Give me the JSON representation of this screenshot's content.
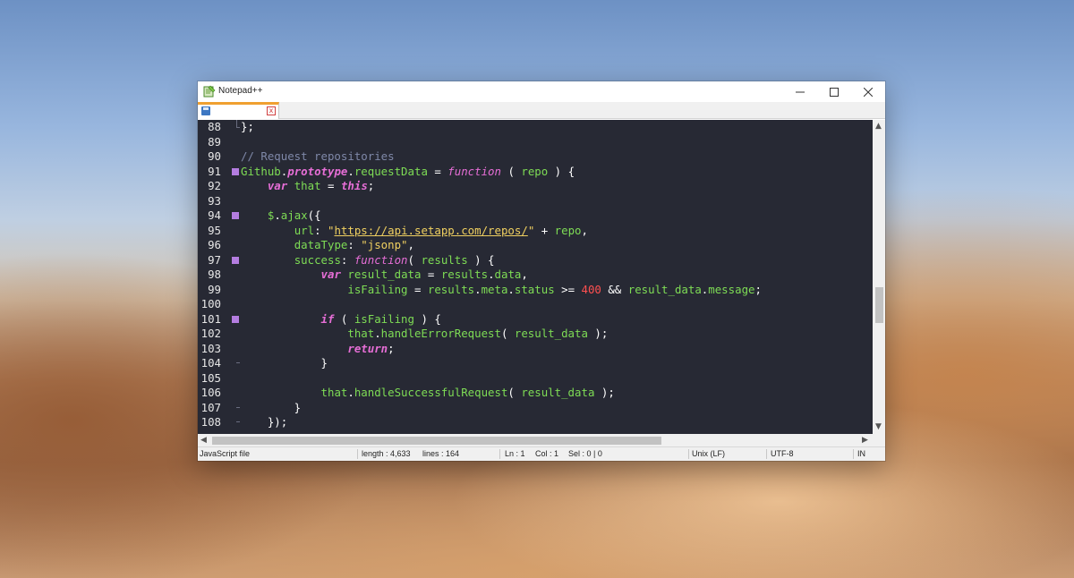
{
  "window": {
    "title": "Notepad++",
    "controls": {
      "minimize": "—",
      "maximize": "☐",
      "close": "✕"
    }
  },
  "tabs": [
    {
      "label": "",
      "close": "x"
    }
  ],
  "editor": {
    "lines": [
      {
        "n": "88",
        "fold": "tick",
        "tokens": [
          [
            "op",
            "};"
          ]
        ]
      },
      {
        "n": "89",
        "fold": "",
        "tokens": []
      },
      {
        "n": "90",
        "fold": "",
        "tokens": [
          [
            "cm",
            "// Request repositories"
          ]
        ]
      },
      {
        "n": "91",
        "fold": "box",
        "tokens": [
          [
            "cl",
            "Github"
          ],
          [
            "op",
            "."
          ],
          [
            "it",
            "prototype"
          ],
          [
            "op",
            "."
          ],
          [
            "pr",
            "requestData"
          ],
          [
            "op",
            " = "
          ],
          [
            "fn",
            "function"
          ],
          [
            "op",
            " ( "
          ],
          [
            "pr",
            "repo"
          ],
          [
            "op",
            " ) {"
          ]
        ]
      },
      {
        "n": "92",
        "fold": "",
        "tokens": [
          [
            "op",
            "    "
          ],
          [
            "kw",
            "var"
          ],
          [
            "op",
            " "
          ],
          [
            "pr",
            "that"
          ],
          [
            "op",
            " = "
          ],
          [
            "kw",
            "this"
          ],
          [
            "op",
            ";"
          ]
        ]
      },
      {
        "n": "93",
        "fold": "",
        "tokens": []
      },
      {
        "n": "94",
        "fold": "box",
        "tokens": [
          [
            "op",
            "    "
          ],
          [
            "pr",
            "$"
          ],
          [
            "op",
            "."
          ],
          [
            "pr",
            "ajax"
          ],
          [
            "op",
            "({"
          ]
        ]
      },
      {
        "n": "95",
        "fold": "",
        "tokens": [
          [
            "op",
            "        "
          ],
          [
            "pr",
            "url"
          ],
          [
            "op",
            ": "
          ],
          [
            "st",
            "\""
          ],
          [
            "url",
            "https://api.setapp.com/repos/"
          ],
          [
            "st",
            "\""
          ],
          [
            "op",
            " + "
          ],
          [
            "pr",
            "repo"
          ],
          [
            "op",
            ","
          ]
        ]
      },
      {
        "n": "96",
        "fold": "",
        "tokens": [
          [
            "op",
            "        "
          ],
          [
            "pr",
            "dataType"
          ],
          [
            "op",
            ": "
          ],
          [
            "st",
            "\"jsonp\""
          ],
          [
            "op",
            ","
          ]
        ]
      },
      {
        "n": "97",
        "fold": "box",
        "tokens": [
          [
            "op",
            "        "
          ],
          [
            "pr",
            "success"
          ],
          [
            "op",
            ": "
          ],
          [
            "fn",
            "function"
          ],
          [
            "op",
            "( "
          ],
          [
            "pr",
            "results"
          ],
          [
            "op",
            " ) {"
          ]
        ]
      },
      {
        "n": "98",
        "fold": "",
        "tokens": [
          [
            "op",
            "            "
          ],
          [
            "kw",
            "var"
          ],
          [
            "op",
            " "
          ],
          [
            "pr",
            "result_data"
          ],
          [
            "op",
            " = "
          ],
          [
            "pr",
            "results"
          ],
          [
            "op",
            "."
          ],
          [
            "pr",
            "data"
          ],
          [
            "op",
            ","
          ]
        ]
      },
      {
        "n": "99",
        "fold": "",
        "tokens": [
          [
            "op",
            "                "
          ],
          [
            "pr",
            "isFailing"
          ],
          [
            "op",
            " = "
          ],
          [
            "pr",
            "results"
          ],
          [
            "op",
            "."
          ],
          [
            "pr",
            "meta"
          ],
          [
            "op",
            "."
          ],
          [
            "pr",
            "status"
          ],
          [
            "op",
            " >= "
          ],
          [
            "nm",
            "400"
          ],
          [
            "op",
            " && "
          ],
          [
            "pr",
            "result_data"
          ],
          [
            "op",
            "."
          ],
          [
            "pr",
            "message"
          ],
          [
            "op",
            ";"
          ]
        ]
      },
      {
        "n": "100",
        "fold": "",
        "tokens": []
      },
      {
        "n": "101",
        "fold": "box",
        "tokens": [
          [
            "op",
            "            "
          ],
          [
            "kw",
            "if"
          ],
          [
            "op",
            " ( "
          ],
          [
            "pr",
            "isFailing"
          ],
          [
            "op",
            " ) {"
          ]
        ]
      },
      {
        "n": "102",
        "fold": "",
        "tokens": [
          [
            "op",
            "                "
          ],
          [
            "pr",
            "that"
          ],
          [
            "op",
            "."
          ],
          [
            "pr",
            "handleErrorRequest"
          ],
          [
            "op",
            "( "
          ],
          [
            "pr",
            "result_data"
          ],
          [
            "op",
            " );"
          ]
        ]
      },
      {
        "n": "103",
        "fold": "",
        "tokens": [
          [
            "op",
            "                "
          ],
          [
            "kw",
            "return"
          ],
          [
            "op",
            ";"
          ]
        ]
      },
      {
        "n": "104",
        "fold": "dash",
        "tokens": [
          [
            "op",
            "            }"
          ]
        ]
      },
      {
        "n": "105",
        "fold": "",
        "tokens": []
      },
      {
        "n": "106",
        "fold": "",
        "tokens": [
          [
            "op",
            "            "
          ],
          [
            "pr",
            "that"
          ],
          [
            "op",
            "."
          ],
          [
            "pr",
            "handleSuccessfulRequest"
          ],
          [
            "op",
            "( "
          ],
          [
            "pr",
            "result_data"
          ],
          [
            "op",
            " );"
          ]
        ]
      },
      {
        "n": "107",
        "fold": "dash",
        "tokens": [
          [
            "op",
            "        }"
          ]
        ]
      },
      {
        "n": "108",
        "fold": "dash",
        "tokens": [
          [
            "op",
            "    });"
          ]
        ]
      }
    ]
  },
  "status": {
    "file_type": "JavaScript file",
    "length": "length : 4,633",
    "lines": "lines : 164",
    "ln": "Ln : 1",
    "col": "Col : 1",
    "sel": "Sel : 0 | 0",
    "eol": "Unix (LF)",
    "encoding": "UTF-8",
    "mode": "IN"
  },
  "icons": {
    "app": "notepad-plus-plus-icon",
    "tab_state": "saved-file-icon",
    "scroll_up": "▲",
    "scroll_down": "▼",
    "scroll_left": "◀",
    "scroll_right": "▶"
  }
}
